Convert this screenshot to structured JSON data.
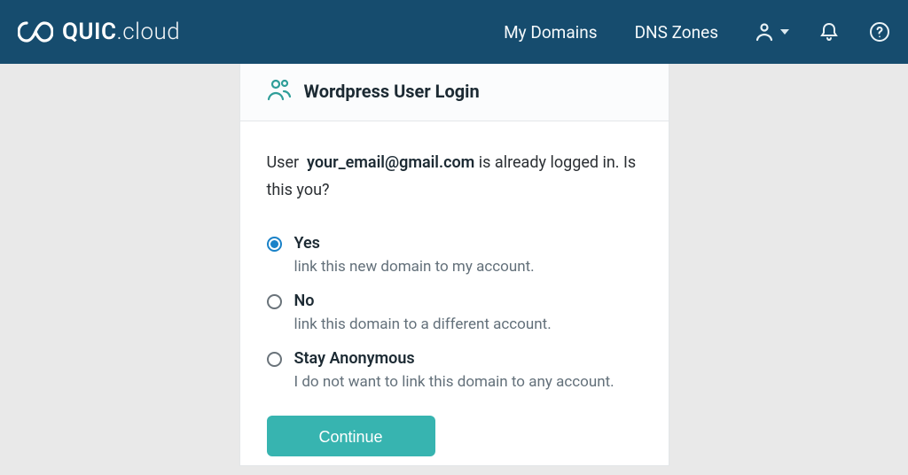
{
  "header": {
    "logo_bold": "QUIC",
    "logo_thin": ".cloud",
    "nav": {
      "my_domains": "My Domains",
      "dns_zones": "DNS Zones"
    }
  },
  "card": {
    "title": "Wordpress User Login",
    "prompt_user": "User",
    "prompt_email": "your_email@gmail.com",
    "prompt_tail": "is already logged in. Is this you?",
    "options": [
      {
        "label": "Yes",
        "desc": "link this new domain to my account.",
        "selected": true
      },
      {
        "label": "No",
        "desc": "link this domain to a different account.",
        "selected": false
      },
      {
        "label": "Stay Anonymous",
        "desc": "I do not want to link this domain to any account.",
        "selected": false
      }
    ],
    "continue_label": "Continue"
  }
}
